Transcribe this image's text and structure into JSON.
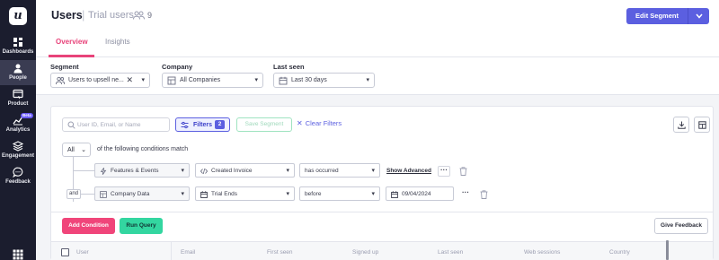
{
  "sidebar": {
    "logo": "u",
    "items": [
      {
        "label": "Dashboards",
        "icon": "dashboard-icon"
      },
      {
        "label": "People",
        "icon": "people-icon",
        "active": true
      },
      {
        "label": "Product",
        "icon": "product-icon"
      },
      {
        "label": "Analytics",
        "icon": "analytics-icon",
        "badge": "Beta"
      },
      {
        "label": "Engagement",
        "icon": "engagement-icon"
      },
      {
        "label": "Feedback",
        "icon": "feedback-icon"
      }
    ],
    "bottom_icon": "apps-grid-icon"
  },
  "header": {
    "title": "Users",
    "separator": "|",
    "subtitle": "Trial users",
    "count": "9",
    "edit_button": "Edit Segment",
    "tabs": [
      {
        "label": "Overview",
        "active": true
      },
      {
        "label": "Insights",
        "active": false
      }
    ]
  },
  "filters": {
    "segment": {
      "label": "Segment",
      "value": "Users to upsell ne..."
    },
    "company": {
      "label": "Company",
      "value": "All Companies"
    },
    "last_seen": {
      "label": "Last seen",
      "value": "Last 30 days"
    }
  },
  "toolbar": {
    "search_placeholder": "User ID, Email, or Name",
    "filters_label": "Filters",
    "filters_count": "2",
    "save_segment": "Save Segment",
    "clear_filters": "Clear Filters"
  },
  "conditions": {
    "match_mode": "All",
    "match_text": "of the following conditions match",
    "joiner": "and",
    "rows": [
      {
        "source": "Features & Events",
        "field": "Created Invoice",
        "operator": "has occurred",
        "extra": "Show Advanced"
      },
      {
        "source": "Company Data",
        "field": "Trial Ends",
        "operator": "before",
        "value": "09/04/2024"
      }
    ]
  },
  "actions": {
    "add_condition": "Add Condition",
    "run_query": "Run Query",
    "give_feedback": "Give Feedback"
  },
  "table": {
    "columns": [
      "User",
      "Email",
      "First seen",
      "Signed up",
      "Last seen",
      "Web sessions",
      "Country"
    ]
  },
  "colors": {
    "accent": "#5b5fe0",
    "pink": "#e8437a",
    "green": "#33d6a0",
    "sidebar": "#1b1d2e"
  }
}
